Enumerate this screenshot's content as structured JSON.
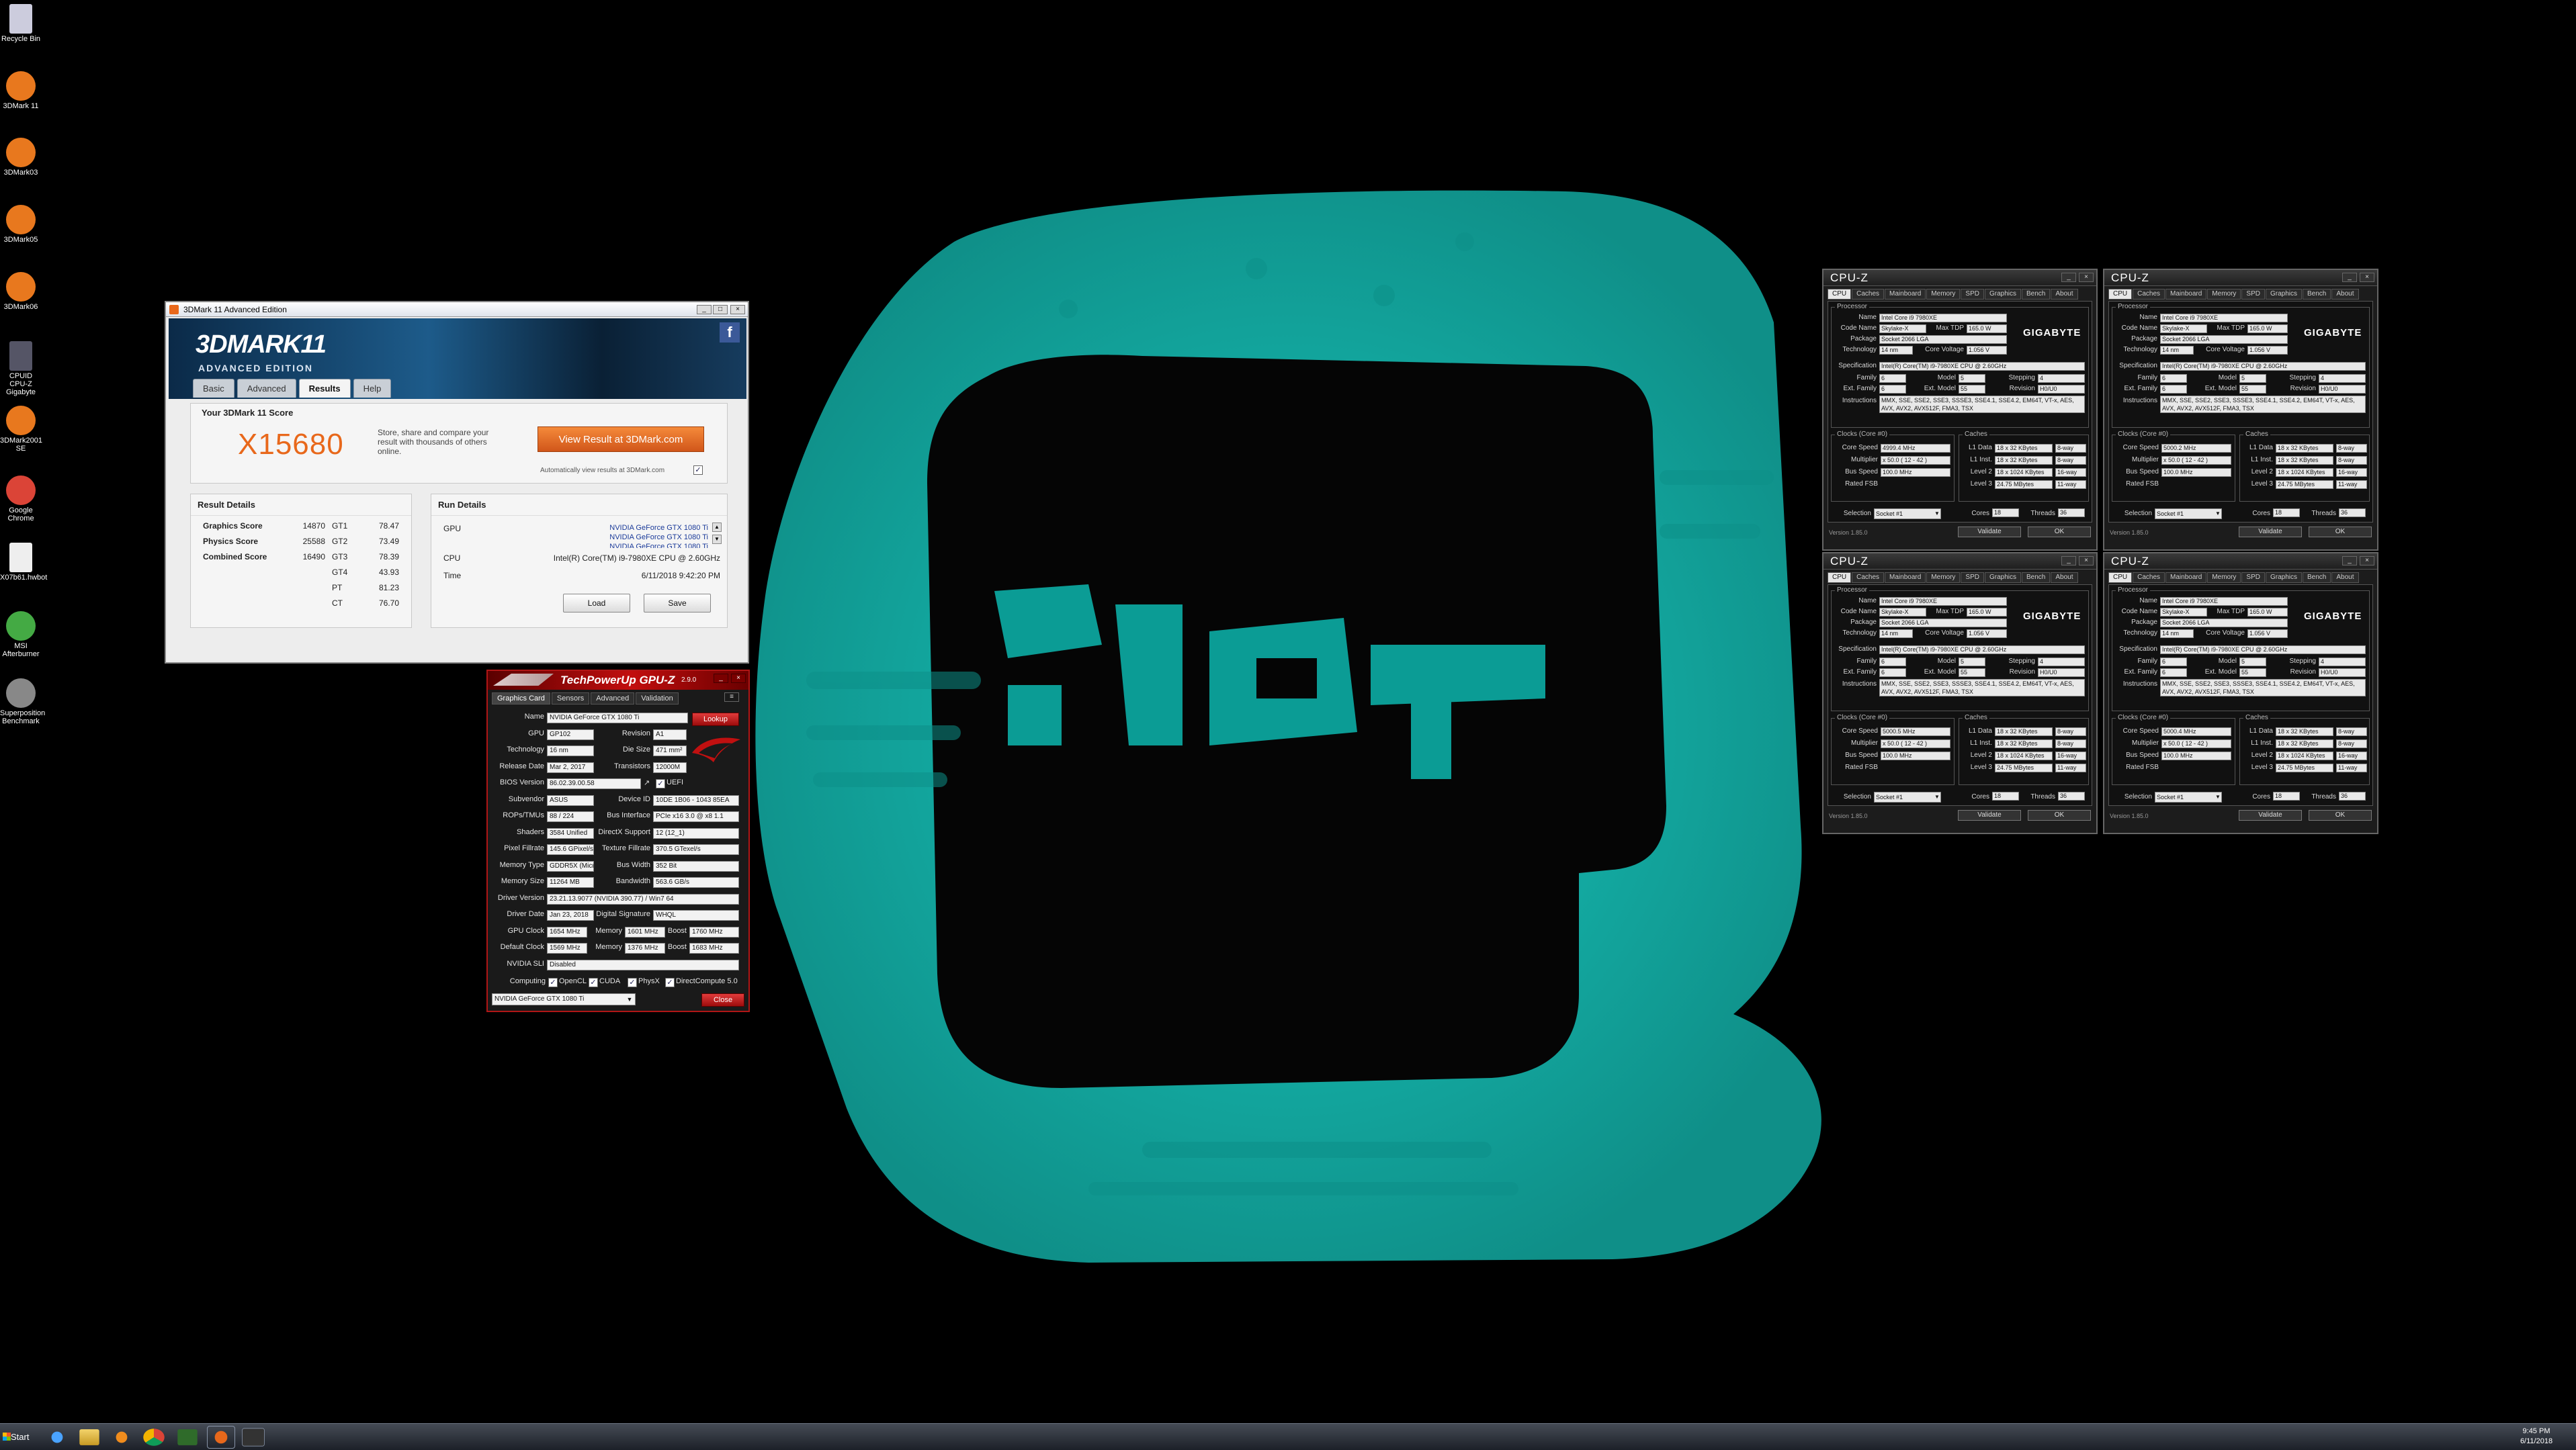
{
  "desktop_icons": [
    {
      "label": "Recycle Bin",
      "icon": "recycle-bin-icon"
    },
    {
      "label": "3DMark 11",
      "icon": "3dmark-icon"
    },
    {
      "label": "3DMark03",
      "icon": "3dmark-icon"
    },
    {
      "label": "3DMark05",
      "icon": "3dmark-icon"
    },
    {
      "label": "3DMark06",
      "icon": "3dmark-icon"
    },
    {
      "label": "CPUID CPU-Z Gigabyte",
      "icon": "cpuz-icon"
    },
    {
      "label": "3DMark2001 SE",
      "icon": "3dmark-icon"
    },
    {
      "label": "Google Chrome",
      "icon": "chrome-icon"
    },
    {
      "label": "X07b61.hwbot",
      "icon": "file-icon"
    },
    {
      "label": "MSI Afterburner",
      "icon": "afterburner-icon"
    },
    {
      "label": "Superposition Benchmark",
      "icon": "superposition-icon"
    }
  ],
  "mark3d": {
    "title": "3DMark 11 Advanced Edition",
    "logo": "3DMARK11",
    "edition": "ADVANCED EDITION",
    "tabs": [
      "Basic",
      "Advanced",
      "Results",
      "Help"
    ],
    "score_heading": "Your 3DMark 11 Score",
    "score": "X15680",
    "blurb": "Store, share and compare your result with thousands of others online.",
    "view_button": "View Result at 3DMark.com",
    "auto_view": "Automatically view results at 3DMark.com",
    "result_details_title": "Result Details",
    "results": [
      {
        "label": "Graphics Score",
        "value": "14870",
        "test": "GT1",
        "fps": "78.47"
      },
      {
        "label": "Physics Score",
        "value": "25588",
        "test": "GT2",
        "fps": "73.49"
      },
      {
        "label": "Combined Score",
        "value": "16490",
        "test": "GT3",
        "fps": "78.39"
      },
      {
        "label": "",
        "value": "",
        "test": "GT4",
        "fps": "43.93"
      },
      {
        "label": "",
        "value": "",
        "test": "PT",
        "fps": "81.23"
      },
      {
        "label": "",
        "value": "",
        "test": "CT",
        "fps": "76.70"
      }
    ],
    "run_details_title": "Run Details",
    "gpu_label": "GPU",
    "gpus": [
      "NVIDIA GeForce GTX 1080 Ti",
      "NVIDIA GeForce GTX 1080 Ti",
      "NVIDIA GeForce GTX 1080 Ti"
    ],
    "cpu_label": "CPU",
    "cpu": "Intel(R) Core(TM) i9-7980XE CPU @ 2.60GHz",
    "time_label": "Time",
    "time": "6/11/2018 9:42:20 PM",
    "load_button": "Load",
    "save_button": "Save"
  },
  "gpuz": {
    "title": "TechPowerUp GPU-Z",
    "version": "2.9.0",
    "tabs": [
      "Graphics Card",
      "Sensors",
      "Advanced",
      "Validation"
    ],
    "lookup": "Lookup",
    "rows": [
      {
        "label": "Name",
        "value": "NVIDIA GeForce GTX 1080 Ti"
      },
      {
        "label": "GPU",
        "value": "GP102",
        "label2": "Revision",
        "value2": "A1"
      },
      {
        "label": "Technology",
        "value": "16 nm",
        "label2": "Die Size",
        "value2": "471 mm²"
      },
      {
        "label": "Release Date",
        "value": "Mar 2, 2017",
        "label2": "Transistors",
        "value2": "12000M"
      },
      {
        "label": "BIOS Version",
        "value": "86.02.39.00.58",
        "label2": "",
        "value2": "UEFI"
      },
      {
        "label": "Subvendor",
        "value": "ASUS",
        "label2": "Device ID",
        "value2": "10DE 1B06 - 1043 85EA"
      },
      {
        "label": "ROPs/TMUs",
        "value": "88 / 224",
        "label2": "Bus Interface",
        "value2": "PCIe x16 3.0 @ x8 1.1"
      },
      {
        "label": "Shaders",
        "value": "3584 Unified",
        "label2": "DirectX Support",
        "value2": "12 (12_1)"
      },
      {
        "label": "Pixel Fillrate",
        "value": "145.6 GPixel/s",
        "label2": "Texture Fillrate",
        "value2": "370.5 GTexel/s"
      },
      {
        "label": "Memory Type",
        "value": "GDDR5X (Micron)",
        "label2": "Bus Width",
        "value2": "352 Bit"
      },
      {
        "label": "Memory Size",
        "value": "11264 MB",
        "label2": "Bandwidth",
        "value2": "563.6 GB/s"
      },
      {
        "label": "Driver Version",
        "value": "23.21.13.9077 (NVIDIA 390.77) / Win7 64"
      },
      {
        "label": "Driver Date",
        "value": "Jan 23, 2018",
        "label2": "Digital Signature",
        "value2": "WHQL"
      },
      {
        "label": "GPU Clock",
        "value": "1654 MHz",
        "label2": "Memory",
        "value2": "1601 MHz",
        "label3": "Boost",
        "value3": "1760 MHz"
      },
      {
        "label": "Default Clock",
        "value": "1569 MHz",
        "label2": "Memory",
        "value2": "1376 MHz",
        "label3": "Boost",
        "value3": "1683 MHz"
      },
      {
        "label": "NVIDIA SLI",
        "value": "Disabled"
      }
    ],
    "computing_label": "Computing",
    "computing": [
      "OpenCL",
      "CUDA",
      "PhysX",
      "DirectCompute 5.0"
    ],
    "selected_card": "NVIDIA GeForce GTX 1080 Ti",
    "close": "Close"
  },
  "cpuz_windows": [
    {
      "core_speed": "4999.4 MHz",
      "version": "Version 1.85.0"
    },
    {
      "core_speed": "5000.2 MHz",
      "version": "Version 1.85.0"
    },
    {
      "core_speed": "5000.5 MHz",
      "version": "Version 1.85.0"
    },
    {
      "core_speed": "5000.4 MHz",
      "version": "Version 1.85.0"
    }
  ],
  "cpuz": {
    "title": "CPU-Z",
    "tabs": [
      "CPU",
      "Caches",
      "Mainboard",
      "Memory",
      "SPD",
      "Graphics",
      "Bench",
      "About"
    ],
    "processor_group": "Processor",
    "name_label": "Name",
    "name": "Intel Core i9 7980XE",
    "codename_label": "Code Name",
    "codename": "Skylake-X",
    "maxtdp_label": "Max TDP",
    "maxtdp": "165.0 W",
    "package_label": "Package",
    "package": "Socket 2066 LGA",
    "tech_label": "Technology",
    "tech": "14 nm",
    "voltage_label": "Core Voltage",
    "voltage": "1.056 V",
    "spec_label": "Specification",
    "spec": "Intel(R) Core(TM) i9-7980XE CPU @ 2.60GHz",
    "family_label": "Family",
    "family": "6",
    "model_label": "Model",
    "model": "5",
    "stepping_label": "Stepping",
    "stepping": "4",
    "extfamily_label": "Ext. Family",
    "extfamily": "6",
    "extmodel_label": "Ext. Model",
    "extmodel": "55",
    "revision_label": "Revision",
    "revision": "H0/U0",
    "instr_label": "Instructions",
    "instr": "MMX, SSE, SSE2, SSE3, SSSE3, SSE4.1, SSE4.2, EM64T, VT-x, AES, AVX, AVX2, AVX512F, FMA3, TSX",
    "clocks_group": "Clocks (Core #0)",
    "corespeed_label": "Core Speed",
    "mult_label": "Multiplier",
    "mult": "x 50.0 ( 12 - 42 )",
    "bus_label": "Bus Speed",
    "bus": "100.0 MHz",
    "fsb_label": "Rated FSB",
    "caches_group": "Caches",
    "l1d_label": "L1 Data",
    "l1d": "18 x 32 KBytes",
    "l1d_way": "8-way",
    "l1i_label": "L1 Inst.",
    "l1i": "18 x 32 KBytes",
    "l1i_way": "8-way",
    "l2_label": "Level 2",
    "l2": "18 x 1024 KBytes",
    "l2_way": "16-way",
    "l3_label": "Level 3",
    "l3": "24.75 MBytes",
    "l3_way": "11-way",
    "selection_label": "Selection",
    "selection": "Socket #1",
    "cores_label": "Cores",
    "cores": "18",
    "threads_label": "Threads",
    "threads": "36",
    "validate": "Validate",
    "ok": "OK",
    "brand": "GIGABYTE"
  },
  "taskbar": {
    "start": "Start",
    "clock_time": "9:45 PM",
    "clock_date": "6/11/2018"
  }
}
